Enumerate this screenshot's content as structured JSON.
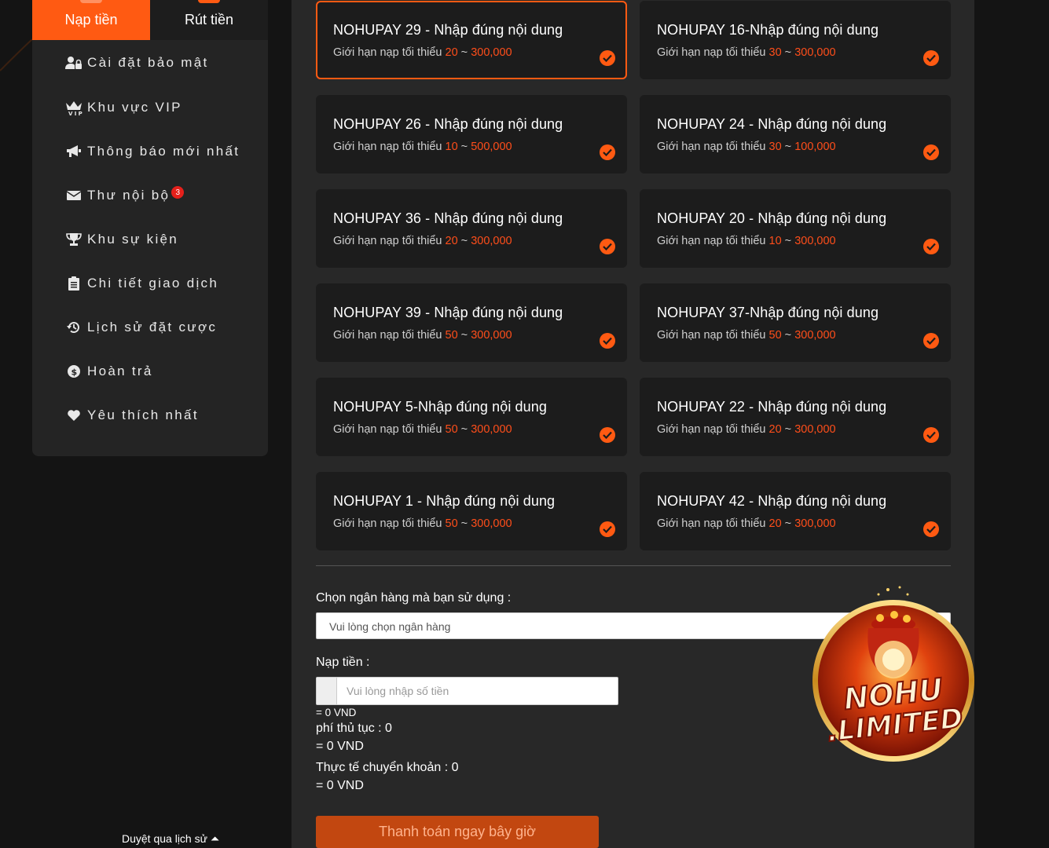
{
  "sidebar": {
    "tabs": [
      {
        "label": "Nạp tiền",
        "active": true
      },
      {
        "label": "Rút tiền",
        "active": false
      }
    ],
    "items": [
      {
        "label": "Cài đặt bảo mật",
        "icon": "user-lock-icon"
      },
      {
        "label": "Khu vực VIP",
        "icon": "vip-crown-icon"
      },
      {
        "label": "Thông báo mới nhất",
        "icon": "megaphone-icon"
      },
      {
        "label": "Thư nội bộ",
        "icon": "envelope-icon",
        "badge": "3"
      },
      {
        "label": "Khu sự kiện",
        "icon": "trophy-icon"
      },
      {
        "label": "Chi tiết giao dịch",
        "icon": "clipboard-icon"
      },
      {
        "label": "Lịch sử đặt cược",
        "icon": "history-icon"
      },
      {
        "label": "Hoàn trả",
        "icon": "dollar-coin-icon"
      },
      {
        "label": "Yêu thích nhất",
        "icon": "heart-icon"
      }
    ],
    "history_link": "Duyệt qua lịch sử ⏶"
  },
  "channels": [
    {
      "title": "NOHUPAY 29 - Nhập đúng nội dung",
      "min": "20",
      "max": "300,000",
      "selected": true
    },
    {
      "title": "NOHUPAY 16-Nhập đúng nội dung",
      "min": "30",
      "max": "300,000"
    },
    {
      "title": "NOHUPAY 26 - Nhập đúng nội dung",
      "min": "10",
      "max": "500,000"
    },
    {
      "title": "NOHUPAY 24 - Nhập đúng nội dung",
      "min": "30",
      "max": "100,000"
    },
    {
      "title": "NOHUPAY 36 - Nhập đúng nội dung",
      "min": "20",
      "max": "300,000"
    },
    {
      "title": "NOHUPAY 20 - Nhập đúng nội dung",
      "min": "10",
      "max": "300,000"
    },
    {
      "title": "NOHUPAY 39 - Nhập đúng nội dung",
      "min": "50",
      "max": "300,000"
    },
    {
      "title": "NOHUPAY 37-Nhập đúng nội dung",
      "min": "50",
      "max": "300,000"
    },
    {
      "title": "NOHUPAY 5-Nhập đúng nội dung",
      "min": "50",
      "max": "300,000"
    },
    {
      "title": "NOHUPAY 22 - Nhập đúng nội dung",
      "min": "20",
      "max": "300,000"
    },
    {
      "title": "NOHUPAY 1 - Nhập đúng nội dung",
      "min": "50",
      "max": "300,000"
    },
    {
      "title": "NOHUPAY 42 - Nhập đúng nội dung",
      "min": "20",
      "max": "300,000"
    }
  ],
  "limit_prefix": "Giới hạn nạp tối thiểu ",
  "limit_sep": " ~ ",
  "form": {
    "bank_label": "Chọn ngân hàng mà bạn sử dụng  :",
    "bank_placeholder": "Vui lòng chọn ngân hàng",
    "amount_label": "Nạp tiền :",
    "amount_placeholder": "Vui lòng nhập số tiền",
    "amount_vnd": "= 0 VND",
    "fee_label": "phí thủ tục :  0",
    "fee_vnd": "= 0 VND",
    "actual_label": "Thực tế chuyển khoản :  0",
    "actual_vnd": "= 0 VND",
    "pay_button": "Thanh toán ngay bây giờ"
  },
  "logo": {
    "line1": "NOHU",
    "line2": ".LIMITED"
  },
  "colors": {
    "accent": "#ff5a12",
    "limit_number": "#ff4e1a",
    "card_bg": "#1c1c1c",
    "panel_bg": "#282828"
  }
}
